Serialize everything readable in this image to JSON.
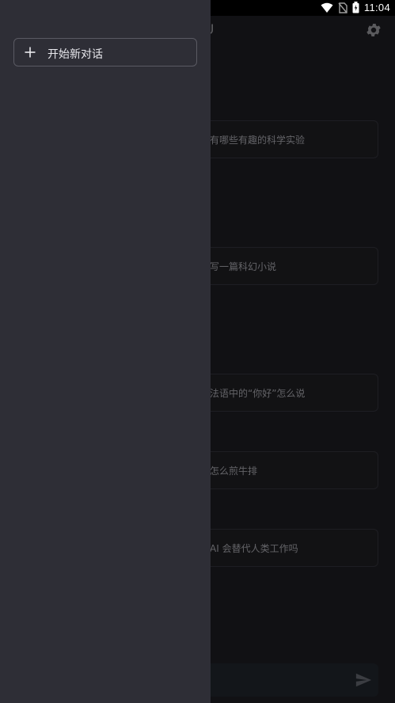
{
  "status_bar": {
    "time": "11:04"
  },
  "header": {
    "title_fragment": "U"
  },
  "suggestions": [
    {
      "text": "有哪些有趣的科学实验"
    },
    {
      "text": "写一篇科幻小说"
    },
    {
      "text": "法语中的“你好”怎么说"
    },
    {
      "text": "怎么煎牛排"
    },
    {
      "text": "AI 会替代人类工作吗"
    }
  ],
  "drawer": {
    "new_chat_label": "开始新对话"
  },
  "colors": {
    "background": "#1b1b1f",
    "drawer": "#2e2e36",
    "card_border": "#2f2f36",
    "muted_text": "#9a9aa0"
  },
  "icons": [
    "wifi-icon",
    "no-sim-icon",
    "battery-icon",
    "gear-icon",
    "send-icon",
    "plus-icon"
  ]
}
